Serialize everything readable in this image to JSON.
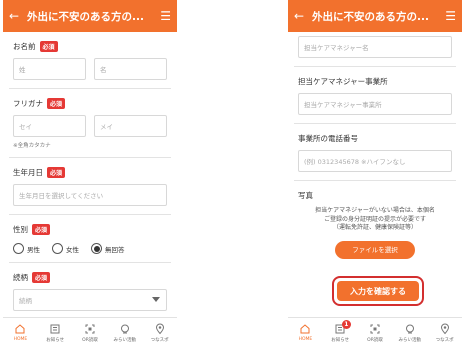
{
  "header": {
    "title": "外出に不安のある方の...",
    "back_icon": "arrow-left-icon",
    "menu_icon": "hamburger-menu-icon",
    "color": "#f2712d"
  },
  "left": {
    "name": {
      "label": "お名前",
      "required": "必須",
      "last_placeholder": "姓",
      "first_placeholder": "名"
    },
    "kana": {
      "label": "フリガナ",
      "required": "必須",
      "last_placeholder": "セイ",
      "first_placeholder": "メイ",
      "note": "※全角カタカナ"
    },
    "birth": {
      "label": "生年月日",
      "required": "必須",
      "placeholder": "生年月日を選択してください"
    },
    "gender": {
      "label": "性別",
      "required": "必須",
      "options": [
        "男性",
        "女性",
        "無回答"
      ],
      "selected": "無回答"
    },
    "relation": {
      "label": "続柄",
      "required": "必須",
      "placeholder": "続柄"
    }
  },
  "right": {
    "care_manager_name_placeholder": "担当ケアマネジャー名",
    "office": {
      "label": "担当ケアマネジャー事業所",
      "placeholder": "担当ケアマネジャー事業所"
    },
    "phone": {
      "label": "事業所の電話番号",
      "placeholder": "(例) 0312345678 ※ハイフンなし"
    },
    "photo": {
      "label": "写真",
      "text_line1": "担当ケアマネジャーがいない場合は、本個名",
      "text_line2": "ご登録の身分証明証の提示が必要です",
      "text_line3": "（運転免許証、健康保険証等）",
      "file_button": "ファイルを選択"
    },
    "confirm_button": "入力を確認する"
  },
  "tabbar": {
    "items": [
      {
        "label": "HOME",
        "icon": "home-icon"
      },
      {
        "label": "お知らせ",
        "icon": "notice-icon"
      },
      {
        "label": "OR読取",
        "icon": "qr-scan-icon"
      },
      {
        "label": "みらい活動",
        "icon": "activity-icon"
      },
      {
        "label": "つなスポ",
        "icon": "location-pin-icon"
      }
    ],
    "badge_count": "1"
  }
}
